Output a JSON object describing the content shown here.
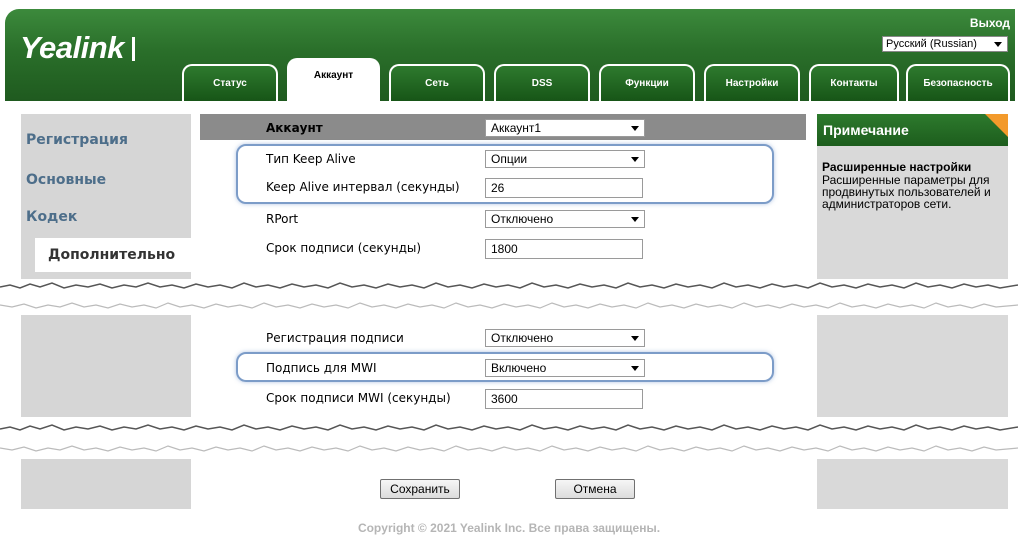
{
  "header": {
    "logo": "Yealink",
    "logout": "Выход",
    "language": "Русский (Russian)",
    "tabs": [
      "Статус",
      "Аккаунт",
      "Сеть",
      "DSS",
      "Функции",
      "Настройки",
      "Контакты",
      "Безопасность"
    ],
    "active_tab": "Аккаунт"
  },
  "sidebar": {
    "items": [
      "Регистрация",
      "Основные",
      "Кодек",
      "Дополнительно"
    ],
    "active": "Дополнительно"
  },
  "form": {
    "account_label": "Аккаунт",
    "account_value": "Аккаунт1",
    "keepalive_type_label": "Тип Keep Alive",
    "keepalive_type_value": "Опции",
    "keepalive_interval_label": "Keep Alive интервал (секунды)",
    "keepalive_interval_value": "26",
    "rport_label": "RPort",
    "rport_value": "Отключено",
    "sub_expiry_label": "Срок подписи (секунды)",
    "sub_expiry_value": "1800",
    "sub_registration_label": "Регистрация подписи",
    "sub_registration_value": "Отключено",
    "mwi_sub_label": "Подпись для MWI",
    "mwi_sub_value": "Включено",
    "mwi_expiry_label": "Срок подписи MWI (секунды)",
    "mwi_expiry_value": "3600",
    "save_label": "Сохранить",
    "cancel_label": "Отмена"
  },
  "note": {
    "title": "Примечание",
    "heading": "Расширенные настройки",
    "text": "Расширенные параметры для продвинутых пользователей и администраторов сети."
  },
  "footer": {
    "copyright": "Copyright © 2021 Yealink Inc. Все права защищены."
  },
  "colors": {
    "brand_green": "#2a6f2a",
    "note_accent": "#f39a2b",
    "highlight_blue": "#7c9cc8",
    "nav_text": "#4d6e8a"
  }
}
